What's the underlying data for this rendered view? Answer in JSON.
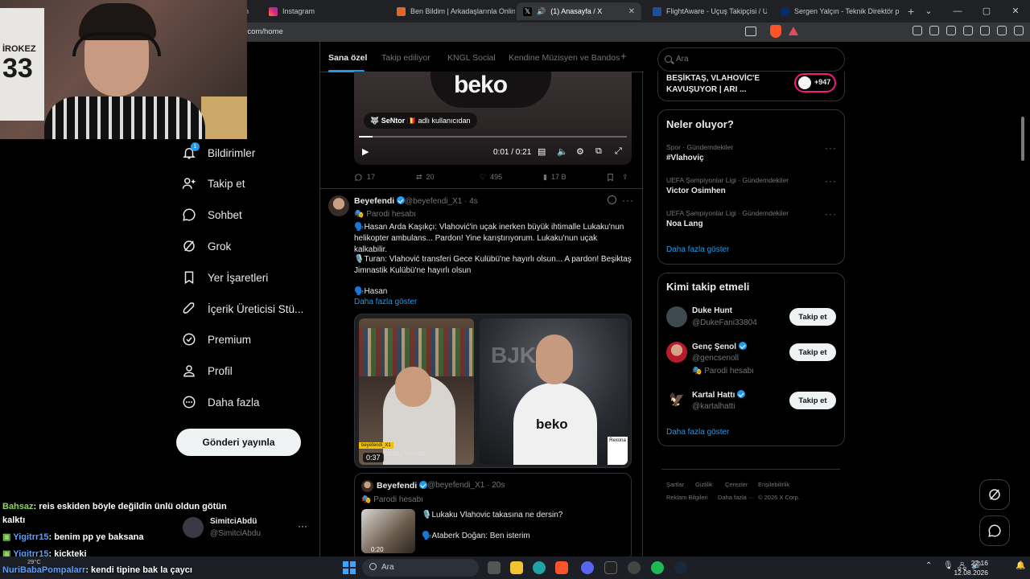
{
  "browser": {
    "tabs": [
      {
        "label": "n"
      },
      {
        "label": "Instagram"
      },
      {
        "label": "Ben Bildim | Arkadaşlarınla Online B"
      },
      {
        "label": "(1) Anasayfa / X"
      },
      {
        "label": "FlightAware - Uçuş Takipçisi / Uçuş"
      },
      {
        "label": "Sergen Yalçın - Teknik Direktör prof"
      }
    ],
    "url": "x.com/home"
  },
  "webcam": {
    "shirt_name": "İROKEZ",
    "shirt_number": "33"
  },
  "nav": {
    "items": [
      {
        "label": "Bildirimler"
      },
      {
        "label": "Takip et"
      },
      {
        "label": "Sohbet"
      },
      {
        "label": "Grok"
      },
      {
        "label": "Yer İşaretleri"
      },
      {
        "label": "İçerik Üreticisi Stü..."
      },
      {
        "label": "Premium"
      },
      {
        "label": "Profil"
      },
      {
        "label": "Daha fazla"
      }
    ],
    "notification_badge": "1",
    "post_button": "Gönderi yayınla",
    "account": {
      "name": "SimitciAbdü",
      "handle": "@SimitciAbdu",
      "more": "···"
    }
  },
  "feed": {
    "tabs": [
      "Sana özel",
      "Takip ediliyor",
      "KNGL Social",
      "Kendine Müzisyen ve Bandos"
    ],
    "add_tab": "+",
    "video": {
      "sponsor_text": "beko",
      "chip_user": "SeNtor",
      "chip_text": "adlı kullanıcıdan",
      "time": "0:01 / 0:21",
      "progress": 0.05
    },
    "video_post_stats": {
      "replies": "17",
      "reposts": "20",
      "likes": "495",
      "views": "17 B"
    },
    "post": {
      "name": "Beyefendi",
      "handle": "@beyefendi_X1 · 4s",
      "sub": "Parodi hesabı",
      "lines": [
        "🗣️Hasan Arda Kaşıkçı: Vlahović'in uçak inerken büyük ihtimalle Lukaku'nun helikopter ambulans... Pardon! Yine karıştırıyorum. Lukaku'nun uçak kalkabilir.",
        "🎙️Turan: Vlahović transferi Gece Kulübü'ne hayırlı olsun... A pardon! Beşiktaş Jimnastik Kulübü'ne hayırlı olsun",
        "🗣️Hasan"
      ],
      "show_more": "Daha fazla göster",
      "media_left": {
        "label": "beyefendi_X1",
        "caption": "CANLI YAYINI",
        "duration": "0:37"
      },
      "media_right": {
        "crest": "BJK",
        "shirt_sponsor": "beko",
        "badge": "Rexona"
      },
      "quote": {
        "name": "Beyefendi",
        "handle": "@beyefendi_X1 · 20s",
        "sub": "Parodi hesabı",
        "line1": "🎙️Lukaku Vlahovic takasına ne dersin?",
        "line2": "🗣️Ataberk Doğan: Ben isterim",
        "thumb_time": "0:20"
      }
    }
  },
  "right": {
    "search_placeholder": "Ara",
    "live_title": "BEŞİKTAŞ, VLAHOVİC'E KAVUŞUYOR | ARI ...",
    "live_count": "+947",
    "trending_title": "Neler oluyor?",
    "trends": [
      {
        "meta": "Spor · Gündemdekiler",
        "name": "#Vlahoviç"
      },
      {
        "meta": "UEFA Şampiyonlar Ligi · Gündemdekiler",
        "name": "Victor Osimhen"
      },
      {
        "meta": "UEFA Şampiyonlar Ligi · Gündemdekiler",
        "name": "Noa Lang"
      }
    ],
    "trends_more": "Daha fazla göster",
    "follow_title": "Kimi takip etmeli",
    "who": [
      {
        "name": "Duke Hunt",
        "handle": "@DukeFani33804",
        "sub": "",
        "button": "Takip et"
      },
      {
        "name": "Genç Şenol",
        "handle": "@gencsenoll",
        "sub": "Parodi hesabı",
        "button": "Takip et"
      },
      {
        "name": "Kartal Hattı",
        "handle": "@kartalhatti",
        "sub": "",
        "button": "Takip et"
      }
    ],
    "who_more": "Daha fazla göster",
    "footer": [
      "Şartlar",
      "Gizlilik",
      "Çerezler",
      "Erişilebilirlik",
      "Reklam Bilgileri",
      "Daha fazla ···",
      "© 2026 X Corp."
    ]
  },
  "chat": [
    {
      "user": "Bahsaz",
      "text": ": reis eskiden böyle değildin ünlü oldun götün"
    },
    {
      "user": "",
      "text": "kalktı"
    },
    {
      "user": "Yigitrr15",
      "text": ": benim pp ye baksana"
    },
    {
      "user": "Yigitrr15",
      "text": ": kickteki"
    },
    {
      "user": "NuriBabaPompalarr",
      "text": ": kendi tipine bak la çaycı"
    }
  ],
  "taskbar": {
    "search": "Ara",
    "time": "22:16",
    "date": "12.08.2026",
    "weather": "29°C"
  }
}
